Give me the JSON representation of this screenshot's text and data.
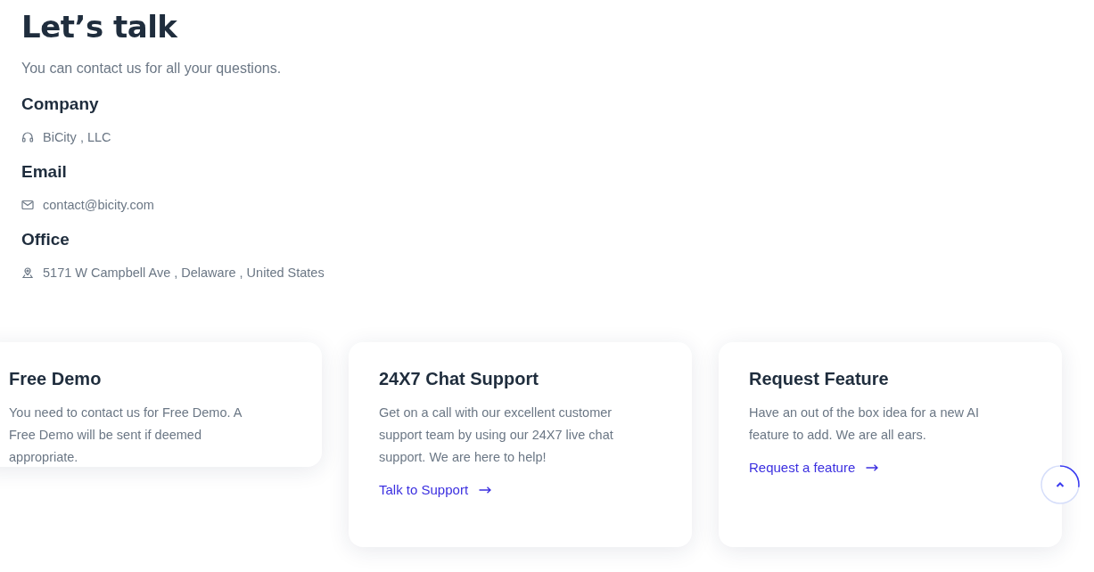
{
  "title": "Let’s talk",
  "subtitle": "You can contact us for all your questions.",
  "contacts": [
    {
      "kind": "company",
      "heading": "Company",
      "value": "BiCity , LLC"
    },
    {
      "kind": "email",
      "heading": "Email",
      "value": "contact@bicity.com"
    },
    {
      "kind": "office",
      "heading": "Office",
      "value": "5171 W Campbell Ave , Delaware , United States"
    }
  ],
  "cards": [
    {
      "title": "Free Demo",
      "text": "You need to contact us for Free Demo. A Free Demo will be sent if deemed appropriate."
    },
    {
      "title": "24X7 Chat Support",
      "text": "Get on a call with our excellent customer support team by using our 24X7 live chat support. We are here to help!",
      "link": "Talk to Support"
    },
    {
      "title": "Request Feature",
      "text": "Have an out of the box idea for a new AI feature to add. We are all ears.",
      "link": "Request a feature"
    }
  ],
  "scroll_top": {
    "level": 0.27
  }
}
